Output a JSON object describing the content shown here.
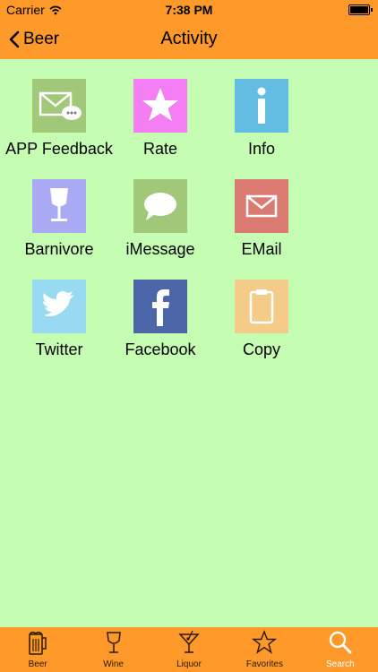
{
  "status": {
    "carrier": "Carrier",
    "time": "7:38 PM"
  },
  "nav": {
    "back_label": "Beer",
    "title": "Activity"
  },
  "tiles": [
    {
      "label": "APP Feedback",
      "icon": "feedback-icon",
      "color": "#a0c878"
    },
    {
      "label": "Rate",
      "icon": "star-icon",
      "color": "#f57ef5"
    },
    {
      "label": "Info",
      "icon": "info-icon",
      "color": "#63bde2"
    },
    {
      "label": "Barnivore",
      "icon": "wine-glass-icon",
      "color": "#a9a9f4"
    },
    {
      "label": "iMessage",
      "icon": "chat-bubble-icon",
      "color": "#a0c878"
    },
    {
      "label": "EMail",
      "icon": "envelope-icon",
      "color": "#da7a70"
    },
    {
      "label": "Twitter",
      "icon": "twitter-bird-icon",
      "color": "#98daf1"
    },
    {
      "label": "Facebook",
      "icon": "facebook-icon",
      "color": "#4d66a9"
    },
    {
      "label": "Copy",
      "icon": "clipboard-icon",
      "color": "#f4cb88"
    }
  ],
  "tabbar": {
    "items": [
      {
        "label": "Beer",
        "icon": "beer-mug-icon"
      },
      {
        "label": "Wine",
        "icon": "wine-glass-icon"
      },
      {
        "label": "Liquor",
        "icon": "cocktail-icon"
      },
      {
        "label": "Favorites",
        "icon": "star-outline-icon"
      },
      {
        "label": "Search",
        "icon": "search-icon",
        "active": true
      }
    ]
  },
  "colors": {
    "bar": "#ff9a2a",
    "background": "#c5feb3"
  }
}
